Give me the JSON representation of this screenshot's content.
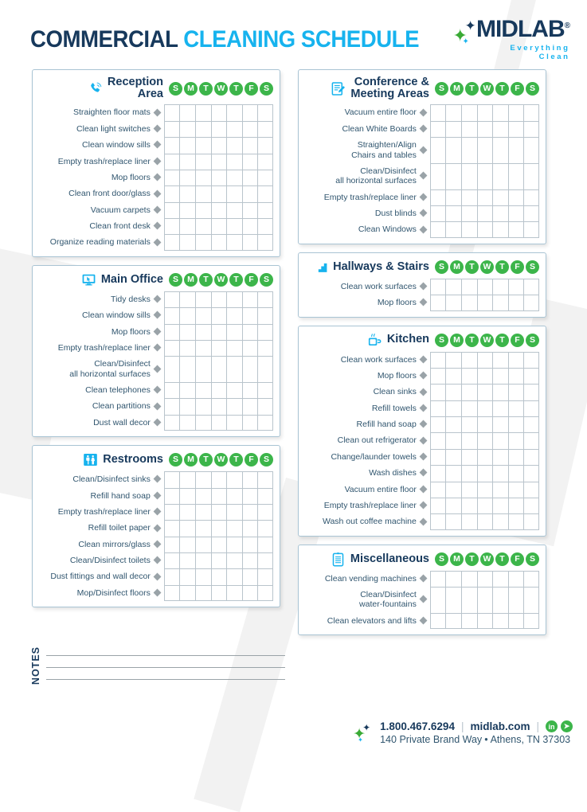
{
  "header": {
    "title_part1": "COMMERCIAL",
    "title_part2": "CLEANING SCHEDULE",
    "logo_name": "MIDLAB",
    "logo_registered": "®",
    "logo_tagline": "Everything Clean"
  },
  "days": [
    "S",
    "M",
    "T",
    "W",
    "T",
    "F",
    "S"
  ],
  "colors": {
    "navy": "#17395c",
    "cyan": "#17b3ee",
    "green": "#3cb54a",
    "label_blue": "#31566f",
    "card_border": "#a9c4d4",
    "grid_line": "#b9c4cc"
  },
  "sections": [
    {
      "id": "reception-area",
      "title": "Reception\nArea",
      "icon": "phone-icon",
      "column": "left",
      "tasks": [
        "Straighten floor mats",
        "Clean light switches",
        "Clean window sills",
        "Empty trash/replace liner",
        "Mop floors",
        "Clean front door/glass",
        "Vacuum carpets",
        "Clean front desk",
        "Organize reading materials"
      ]
    },
    {
      "id": "main-office",
      "title": "Main Office",
      "icon": "monitor-icon",
      "column": "left",
      "tasks": [
        "Tidy desks",
        "Clean window sills",
        "Mop floors",
        "Empty trash/replace liner",
        "Clean/Disinfect\nall horizontal surfaces",
        "Clean telephones",
        "Clean partitions",
        "Dust wall decor"
      ]
    },
    {
      "id": "restrooms",
      "title": "Restrooms",
      "icon": "restroom-icon",
      "column": "left",
      "tasks": [
        "Clean/Disinfect sinks",
        "Refill hand soap",
        "Empty trash/replace liner",
        "Refill toilet paper",
        "Clean mirrors/glass",
        "Clean/Disinfect toilets",
        "Dust fittings and wall decor",
        "Mop/Disinfect floors"
      ]
    },
    {
      "id": "conference-meeting-areas",
      "title": "Conference &\nMeeting Areas",
      "icon": "clipboard-pen-icon",
      "column": "right",
      "tasks": [
        "Vacuum entire floor",
        "Clean White Boards",
        "Straighten/Align\nChairs and tables",
        "Clean/Disinfect\nall horizontal surfaces",
        "Empty trash/replace liner",
        "Dust blinds",
        "Clean Windows"
      ]
    },
    {
      "id": "hallways-stairs",
      "title": "Hallways & Stairs",
      "icon": "stairs-icon",
      "column": "right",
      "tasks": [
        "Clean work surfaces",
        "Mop floors"
      ]
    },
    {
      "id": "kitchen",
      "title": "Kitchen",
      "icon": "coffee-cup-icon",
      "column": "right",
      "tasks": [
        "Clean work surfaces",
        "Mop floors",
        "Clean sinks",
        "Refill towels",
        "Refill hand soap",
        "Clean out refrigerator",
        "Change/launder towels",
        "Wash dishes",
        "Vacuum entire floor",
        "Empty trash/replace liner",
        "Wash out coffee machine"
      ]
    },
    {
      "id": "miscellaneous",
      "title": "Miscellaneous",
      "icon": "clipboard-icon",
      "column": "right",
      "tasks": [
        "Clean vending machines",
        "Clean/Disinfect\nwater-fountains",
        "Clean elevators and lifts"
      ]
    }
  ],
  "notes": {
    "label": "NOTES",
    "line_count": 3
  },
  "footer": {
    "phone": "1.800.467.6294",
    "website": "midlab.com",
    "address_street": "140 Private Brand Way",
    "address_separator": "•",
    "address_city": "Athens, TN 37303",
    "social": [
      {
        "name": "linkedin-icon",
        "glyph": "in"
      },
      {
        "name": "twitter-icon",
        "glyph": "ᴠ"
      }
    ]
  }
}
